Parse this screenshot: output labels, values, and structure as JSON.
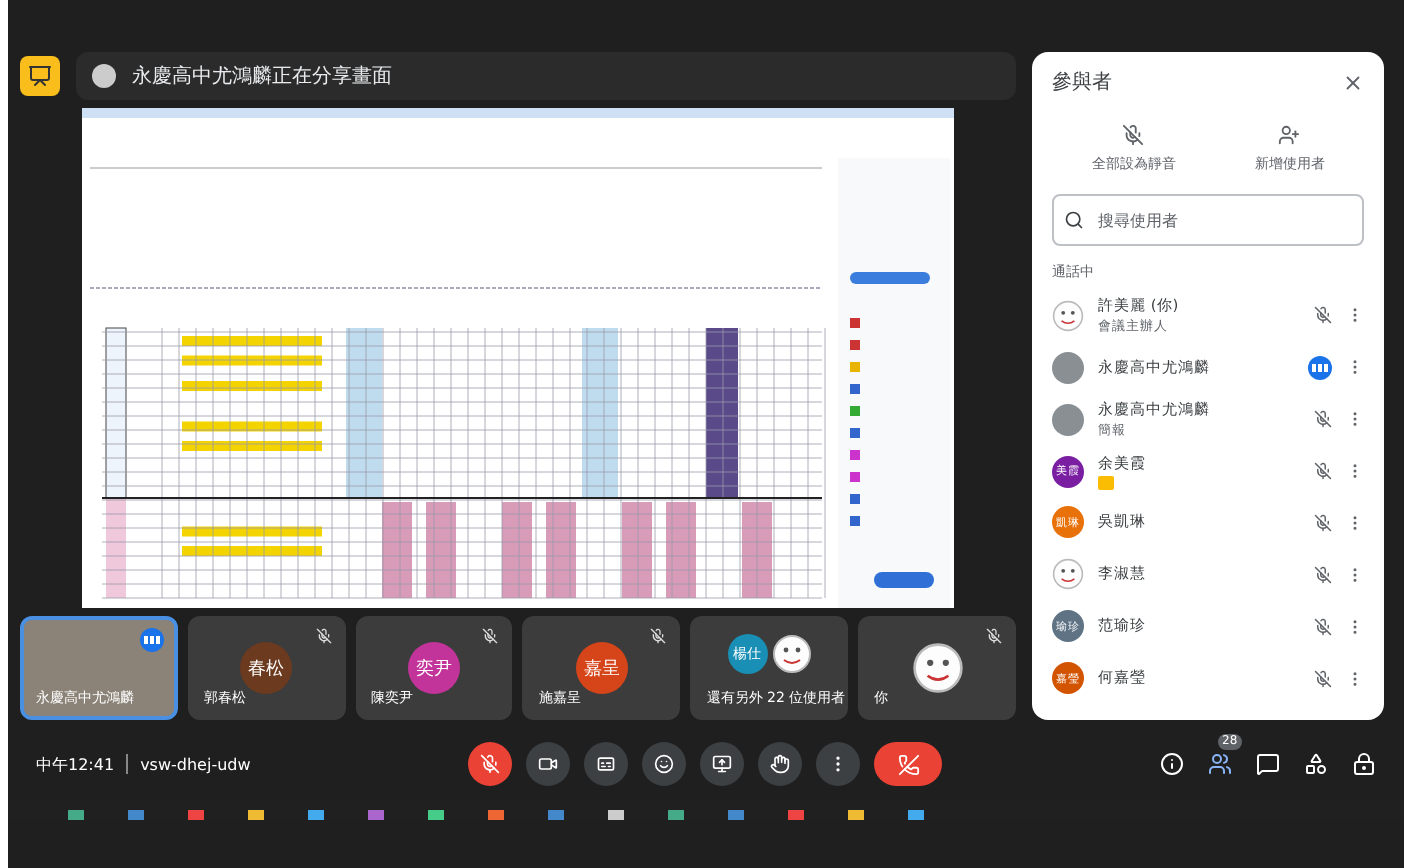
{
  "top_bar": {
    "presenting_text": "永慶高中尤鴻麟正在分享畫面"
  },
  "tiles": [
    {
      "name": "永慶高中尤鴻麟",
      "kind": "video",
      "muted": false,
      "speaking": true
    },
    {
      "name": "郭春松",
      "kind": "initials",
      "initials": "春松",
      "color": "#6b3a1f",
      "muted": true,
      "speaking": false
    },
    {
      "name": "陳奕尹",
      "kind": "initials",
      "initials": "奕尹",
      "color": "#c2349a",
      "muted": true,
      "speaking": false
    },
    {
      "name": "施嘉呈",
      "kind": "initials",
      "initials": "嘉呈",
      "color": "#d6451a",
      "muted": true,
      "speaking": false
    },
    {
      "name": "還有另外 22 位使用者",
      "kind": "group",
      "initials": "楊仕",
      "color": "#1a8fb5",
      "muted": false,
      "speaking": false
    },
    {
      "name": "你",
      "kind": "drawing",
      "muted": true,
      "speaking": false
    }
  ],
  "panel": {
    "title": "參與者",
    "actions": [
      "全部設為靜音",
      "新增使用者"
    ],
    "search": {
      "placeholder": "搜尋使用者"
    },
    "section": "通話中",
    "people": [
      {
        "name": "許美麗 (你)",
        "subtitle": "會議主辦人",
        "kind": "drawing",
        "muted": true,
        "speaking": false,
        "hand_raised": false
      },
      {
        "name": "永慶高中尤鴻麟",
        "kind": "photo",
        "muted": false,
        "speaking": true,
        "hand_raised": false
      },
      {
        "name": "永慶高中尤鴻麟",
        "subtitle": "簡報",
        "kind": "photo",
        "muted": true,
        "speaking": false,
        "hand_raised": false
      },
      {
        "name": "余美霞",
        "kind": "initials",
        "initials": "美霞",
        "color": "#7b1fa2",
        "muted": true,
        "speaking": false,
        "hand_raised": true
      },
      {
        "name": "吳凱琳",
        "kind": "initials",
        "initials": "凱琳",
        "color": "#e8710a",
        "muted": true,
        "speaking": false,
        "hand_raised": false
      },
      {
        "name": "李淑慧",
        "kind": "drawing",
        "muted": true,
        "speaking": false,
        "hand_raised": false
      },
      {
        "name": "范瑜珍",
        "kind": "initials",
        "initials": "瑜珍",
        "color": "#5f7385",
        "muted": true,
        "speaking": false,
        "hand_raised": false
      },
      {
        "name": "何嘉瑩",
        "kind": "initials",
        "initials": "嘉瑩",
        "color": "#d35400",
        "muted": true,
        "speaking": false,
        "hand_raised": false
      }
    ]
  },
  "bottom_bar": {
    "time": "中午12:41",
    "meeting_code": "vsw-dhej-udw",
    "mic_on": false,
    "people_count": "28",
    "people_selected": true
  }
}
